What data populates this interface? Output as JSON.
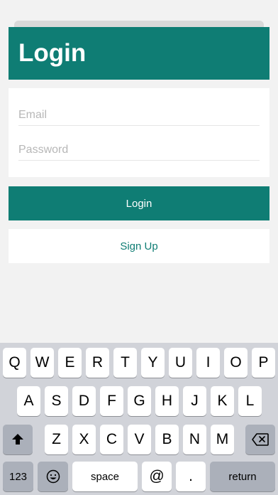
{
  "header": {
    "title": "Login"
  },
  "form": {
    "email_placeholder": "Email",
    "password_placeholder": "Password"
  },
  "buttons": {
    "login_label": "Login",
    "signup_label": "Sign Up"
  },
  "keyboard": {
    "row1": [
      "Q",
      "W",
      "E",
      "R",
      "T",
      "Y",
      "U",
      "I",
      "O",
      "P"
    ],
    "row2": [
      "A",
      "S",
      "D",
      "F",
      "G",
      "H",
      "J",
      "K",
      "L"
    ],
    "row3": [
      "Z",
      "X",
      "C",
      "V",
      "B",
      "N",
      "M"
    ],
    "numbers_label": "123",
    "space_label": "space",
    "at_label": "@",
    "period_label": ".",
    "return_label": "return",
    "shift_icon": "shift-icon",
    "backspace_icon": "backspace-icon",
    "emoji_icon": "emoji-icon"
  },
  "colors": {
    "accent": "#0f7d74",
    "background": "#f2f2f2",
    "keyboard_bg": "#d1d3d9"
  }
}
